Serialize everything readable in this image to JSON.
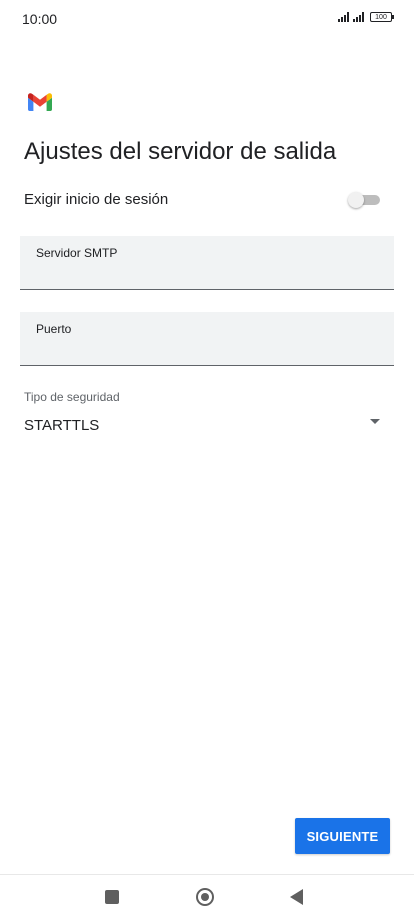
{
  "status_bar": {
    "time": "10:00",
    "battery": "100"
  },
  "app": {
    "logo": "gmail-logo"
  },
  "page": {
    "title": "Ajustes del servidor de salida"
  },
  "login_required": {
    "label": "Exigir inicio de sesión",
    "enabled": false
  },
  "fields": {
    "smtp_server": {
      "label": "Servidor SMTP",
      "value": ""
    },
    "port": {
      "label": "Puerto",
      "value": ""
    }
  },
  "security": {
    "label": "Tipo de seguridad",
    "selected": "STARTTLS"
  },
  "actions": {
    "next_label": "SIGUIENTE"
  },
  "colors": {
    "accent": "#1a73e8",
    "field_bg": "#f1f3f4"
  },
  "nav_bar": {
    "icons": [
      "recents-icon",
      "home-icon",
      "back-icon"
    ]
  }
}
